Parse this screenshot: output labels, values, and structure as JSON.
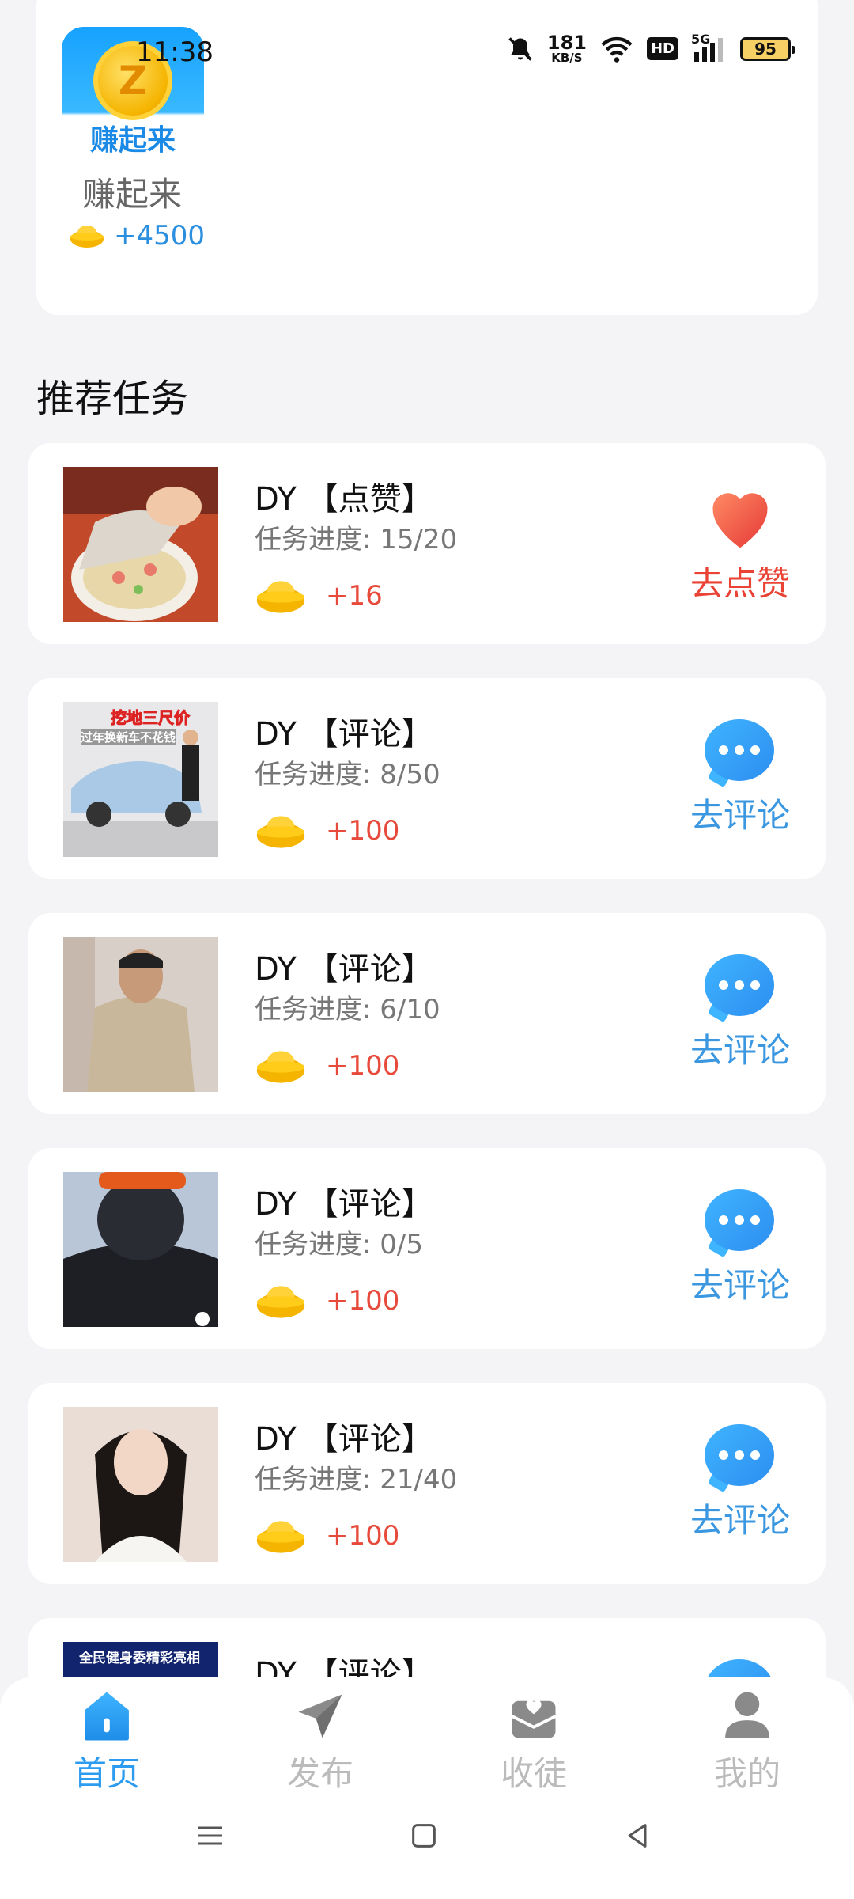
{
  "status_bar": {
    "time": "11:38",
    "net_speed_value": "181",
    "net_speed_unit": "KB/S",
    "hd": "HD",
    "network": "5G",
    "battery": "95"
  },
  "app_card": {
    "icon_letter": "Z",
    "icon_text": "赚起来",
    "name": "赚起来",
    "reward": "+4500"
  },
  "section_title": "推荐任务",
  "tasks": [
    {
      "title": "DY 【点赞】",
      "progress_label": "任务进度: 15/20",
      "reward": "+16",
      "action": "去点赞",
      "action_type": "like"
    },
    {
      "title": "DY 【评论】",
      "progress_label": "任务进度: 8/50",
      "reward": "+100",
      "action": "去评论",
      "action_type": "comment",
      "thumb_caption_1": "挖地三尺价",
      "thumb_caption_2": "过年换新车不花钱"
    },
    {
      "title": "DY 【评论】",
      "progress_label": "任务进度: 6/10",
      "reward": "+100",
      "action": "去评论",
      "action_type": "comment"
    },
    {
      "title": "DY 【评论】",
      "progress_label": "任务进度: 0/5",
      "reward": "+100",
      "action": "去评论",
      "action_type": "comment"
    },
    {
      "title": "DY 【评论】",
      "progress_label": "任务进度: 21/40",
      "reward": "+100",
      "action": "去评论",
      "action_type": "comment"
    },
    {
      "title": "DY 【评论】",
      "thumb_caption_1": "全民健身委精彩亮相",
      "action_type": "comment"
    }
  ],
  "bottom_nav": [
    {
      "label": "首页",
      "icon": "home-icon",
      "active": true
    },
    {
      "label": "发布",
      "icon": "send-icon",
      "active": false
    },
    {
      "label": "收徒",
      "icon": "mailbox-heart-icon",
      "active": false
    },
    {
      "label": "我的",
      "icon": "person-icon",
      "active": false
    }
  ],
  "colors": {
    "accent": "#2d9cf0",
    "reward_red": "#e74a3b",
    "like_red": "#ea4335",
    "comment_blue": "#3b97e0"
  }
}
